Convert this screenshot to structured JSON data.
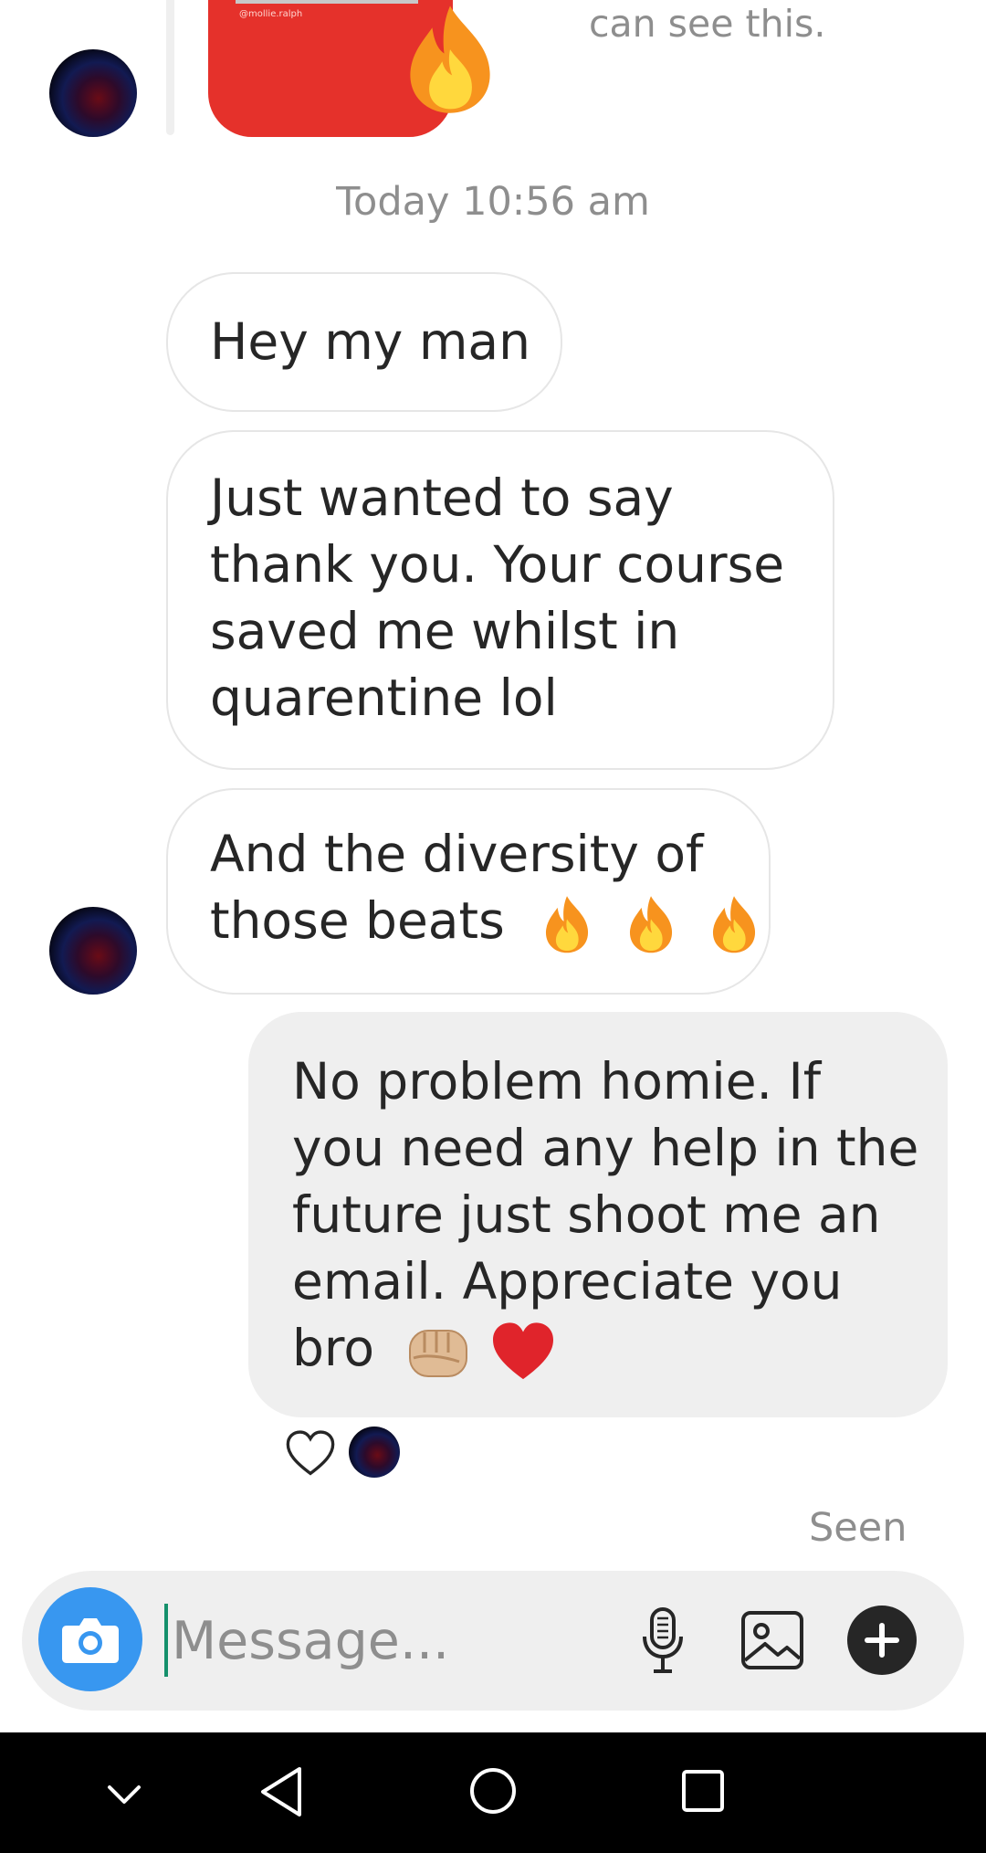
{
  "shared_story": {
    "handle": "@mollie.ralph",
    "note": "can see this."
  },
  "timestamp": "Today 10:56 am",
  "messages": {
    "m1": {
      "lines": [
        "Hey my man"
      ]
    },
    "m2": {
      "lines": [
        "Just wanted to say",
        "thank you. Your course",
        "saved me whilst in",
        "quarentine lol"
      ]
    },
    "m3": {
      "lines": [
        "And the diversity of",
        "those beats"
      ]
    },
    "m4": {
      "lines": [
        "No problem homie. If",
        "you need any help in the",
        "future just shoot me an",
        "email. Appreciate you",
        "bro"
      ]
    }
  },
  "emojis": {
    "fire": "fire-emoji",
    "fist": "fist-bump-emoji",
    "heart": "red-heart-emoji"
  },
  "seen_label": "Seen",
  "composer": {
    "placeholder": "Message..."
  },
  "colors": {
    "accent": "#3897f0",
    "incoming_border": "#e6e6e6",
    "outgoing_bg": "#efefef",
    "meta_text": "#8e8e8e"
  }
}
